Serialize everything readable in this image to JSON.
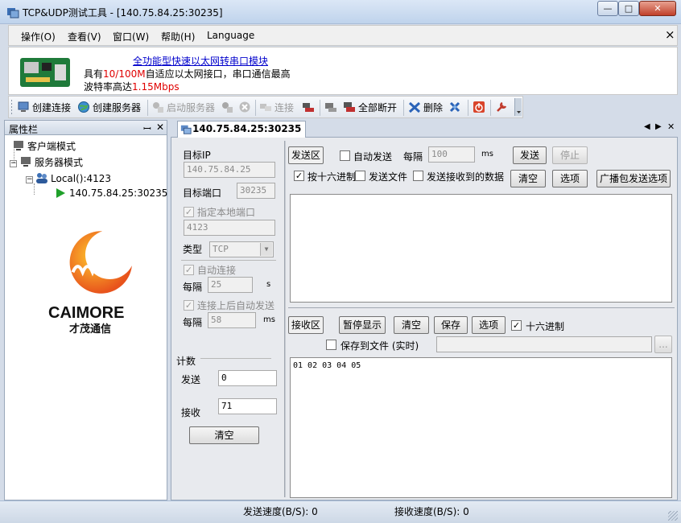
{
  "window": {
    "title": "TCP&UDP测试工具 - [140.75.84.25:30235]",
    "min_label": "—",
    "max_label": "□",
    "close_label": "✕"
  },
  "menu": {
    "items": [
      "操作(O)",
      "查看(V)",
      "窗口(W)",
      "帮助(H)",
      "Language"
    ],
    "close_label": "×"
  },
  "banner": {
    "link": "全功能型快速以太网转串口模块",
    "line1_pre": "具有",
    "line1_red": "10/100M",
    "line1_post": "自适应以太网接口，串口通信最高",
    "line2_pre": "波特率高达",
    "line2_red": "1.15Mbps"
  },
  "toolbar": {
    "create_conn": "创建连接",
    "create_server": "创建服务器",
    "start_server": "启动服务器",
    "connect": "连接",
    "disconnect_all": "全部断开",
    "delete": "删除"
  },
  "properties": {
    "title": "属性栏",
    "pin": "ꟷ",
    "close": "✕",
    "tree": {
      "client_mode": "客户端模式",
      "server_mode": "服务器模式",
      "local": "Local():4123",
      "connection": "140.75.84.25:30235"
    },
    "logo_text": "CAIMORE",
    "logo_sub": "才茂通信"
  },
  "tab": {
    "label": "140.75.84.25:30235"
  },
  "settings": {
    "target_ip_label": "目标IP",
    "target_ip": "140.75.84.25",
    "target_port_label": "目标端口",
    "target_port": "30235",
    "local_port_label": "指定本地端口",
    "local_port": "4123",
    "type_label": "类型",
    "type_value": "TCP",
    "auto_connect_label": "自动连接",
    "every_label": "每隔",
    "every_value": "25",
    "unit_s": "s",
    "auto_send_after_connect_label": "连接上后自动发送",
    "every2_label": "每隔",
    "every2_value": "58",
    "unit_ms": "ms"
  },
  "counter": {
    "title": "计数",
    "send_label": "发送",
    "send_value": "0",
    "recv_label": "接收",
    "recv_value": "71",
    "clear_label": "清空"
  },
  "send_area": {
    "title": "发送区",
    "auto_send": "自动发送",
    "every": "每隔",
    "interval": "100",
    "ms": "ms",
    "send_btn": "发送",
    "stop_btn": "停止",
    "hex": "按十六进制",
    "send_file": "发送文件",
    "send_received": "发送接收到的数据",
    "clear_btn": "清空",
    "options_btn": "选项",
    "broadcast_btn": "广播包发送选项"
  },
  "recv_area": {
    "title": "接收区",
    "pause_btn": "暂停显示",
    "clear_btn": "清空",
    "save_btn": "保存",
    "options_btn": "选项",
    "hex": "十六进制",
    "save_to_file": "保存到文件 (实时)",
    "browse": "...",
    "content": "01 02 03 04 05"
  },
  "status": {
    "send_speed": "发送速度(B/S): 0",
    "recv_speed": "接收速度(B/S): 0"
  }
}
